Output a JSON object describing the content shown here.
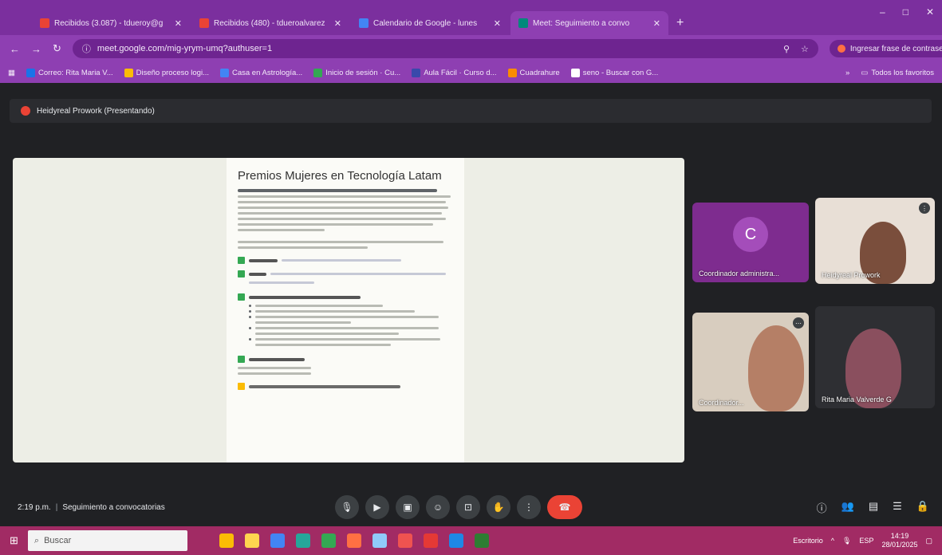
{
  "browser": {
    "tabs": [
      {
        "title": "Recibidos (3.087) - tdueroy@g",
        "color": "#ea4335"
      },
      {
        "title": "Recibidos (480) - tdueroalvarez",
        "color": "#ea4335"
      },
      {
        "title": "Calendario de Google - lunes",
        "color": "#4285f4"
      },
      {
        "title": "Meet: Seguimiento a convo",
        "color": "#00897b"
      }
    ],
    "new_tab": "+",
    "window_controls": [
      "–",
      "□",
      "✕"
    ],
    "url": "meet.google.com/mig-yrym-umq?authuser=1",
    "password_button": "Ingresar frase de contraseña",
    "bookmarks": [
      {
        "label": "Correo: Rita Maria V...",
        "color": "#1a73e8"
      },
      {
        "label": "Diseño proceso logi...",
        "color": "#fbbc05"
      },
      {
        "label": "Casa en Astrología...",
        "color": "#4285f4"
      },
      {
        "label": "Inicio de sesión · Cu...",
        "color": "#34a853"
      },
      {
        "label": "Aula Fácil · Curso d...",
        "color": "#3949ab"
      },
      {
        "label": "Cuadrahure",
        "color": "#fb8c00"
      },
      {
        "label": "seno - Buscar con G...",
        "color": "#ffffff"
      }
    ],
    "all_bookmarks": "Todos los favoritos"
  },
  "meet": {
    "presenter_label": "Heidyreal Prowork (Presentando)",
    "slide": {
      "title": "Premios Mujeres en Tecnología Latam"
    },
    "participants": [
      {
        "name": "Coordinador administra...",
        "initial": "C"
      },
      {
        "name": "Heidyreal Prowork"
      },
      {
        "name": "Coordinador..."
      },
      {
        "name": "Rita Maria Valverde G"
      }
    ],
    "time": "2:19 p.m.",
    "separator": "|",
    "meeting_title": "Seguimiento a convocatorias"
  },
  "taskbar": {
    "search_placeholder": "Buscar",
    "tray_label": "Escritorio",
    "lang": "ESP",
    "clock_time": "14:19",
    "clock_date": "28/01/2025"
  }
}
